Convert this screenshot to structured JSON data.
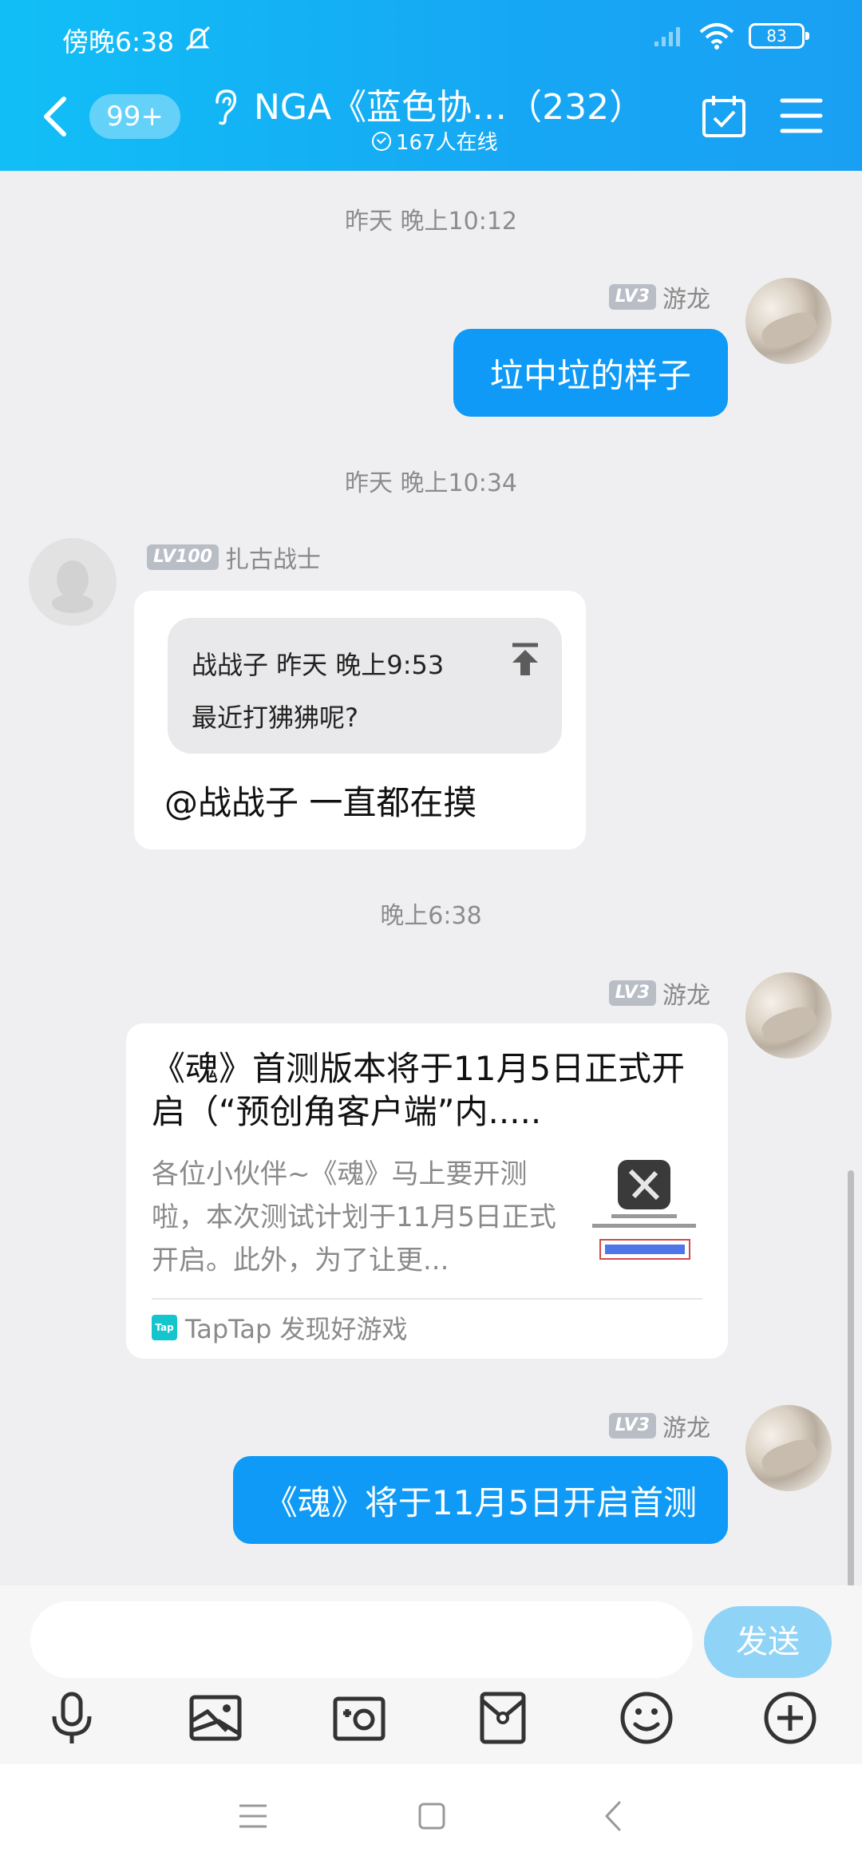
{
  "status_bar": {
    "time": "傍晚6:38",
    "battery": "83"
  },
  "header": {
    "unread": "99+",
    "title": "NGA《蓝色协…（232）",
    "online": "167人在线"
  },
  "messages": [
    {
      "timestamp": "昨天 晚上10:12"
    },
    {
      "sender_level": "LV3",
      "sender": "游龙",
      "text": "垃中垃的样子"
    },
    {
      "timestamp": "昨天 晚上10:34"
    },
    {
      "sender_level": "LV100",
      "sender": "扎古战士",
      "quote_head": "战战子 昨天 晚上9:53",
      "quote_text": "最近打狒狒呢?",
      "text": "@战战子 一直都在摸"
    },
    {
      "timestamp": "晚上6:38"
    },
    {
      "sender_level": "LV3",
      "sender": "游龙",
      "card_title": "《魂》首测版本将于11月5日正式开启（“预创角客户端”内.....",
      "card_desc": "各位小伙伴~《魂》马上要开测啦，本次测试计划于11月5日正式开启。此外，为了让更...",
      "card_source": "TapTap 发现好游戏",
      "card_logo": "Tap"
    },
    {
      "sender_level": "LV3",
      "sender": "游龙",
      "text": "《魂》将于11月5日开启首测"
    }
  ],
  "input": {
    "placeholder": "",
    "send_label": "发送"
  },
  "toolbar": [
    "mic-icon",
    "image-icon",
    "camera-icon",
    "red-packet-icon",
    "emoji-icon",
    "plus-icon"
  ],
  "colors": {
    "accent": "#0e9af6",
    "header": "#16a7f4",
    "send_disabled": "#8fd3f7"
  }
}
